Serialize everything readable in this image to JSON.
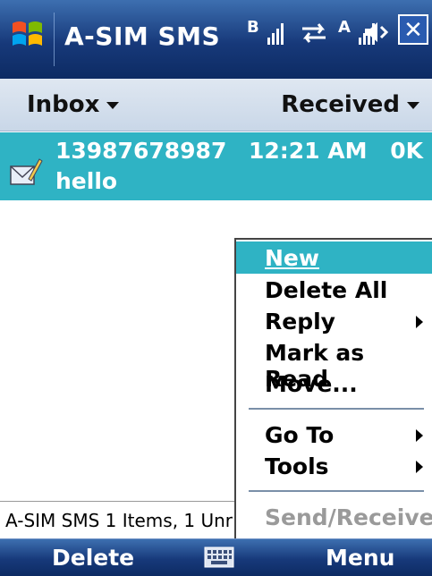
{
  "titlebar": {
    "title": "A-SIM SMS",
    "sim1_label": "B",
    "sim2_label": "A"
  },
  "header": {
    "folder": "Inbox",
    "sort": "Received"
  },
  "messages": [
    {
      "sender": "13987678987",
      "time": "12:21 AM",
      "size": "0K",
      "preview": "hello"
    }
  ],
  "status": {
    "text": "A-SIM SMS  1 Items, 1 Unr"
  },
  "menu": {
    "items": [
      {
        "label": "New",
        "selected": true
      },
      {
        "label": "Delete All"
      },
      {
        "label": "Reply",
        "submenu": true
      },
      {
        "label": "Mark as Read"
      },
      {
        "label": "Move..."
      },
      {
        "label": "Go To",
        "submenu": true
      },
      {
        "label": "Tools",
        "submenu": true
      },
      {
        "label": "Send/Receive",
        "disabled": true
      }
    ]
  },
  "softkeys": {
    "left": "Delete",
    "right": "Menu"
  },
  "colors": {
    "titlebar": "#17397a",
    "selection": "#2fb3c4"
  }
}
